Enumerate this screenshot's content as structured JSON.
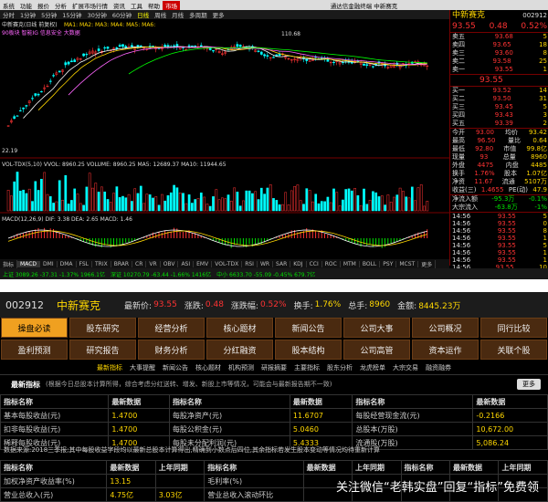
{
  "menubar": {
    "items": [
      "系统",
      "功能",
      "报价",
      "分析",
      "扩展市场行情",
      "资讯",
      "工具",
      "帮助",
      "市场"
    ],
    "title": "通达信金融终端 中新赛克"
  },
  "toolbar": {
    "items": [
      "分时",
      "1分钟",
      "5分钟",
      "15分钟",
      "30分钟",
      "60分钟",
      "日线",
      "周线",
      "月线",
      "多周期",
      "更多"
    ]
  },
  "chart_info": {
    "header": "中新赛克(日线 前复权)",
    "ma_line": "MA1:  MA2:  MA3:  MA4:  MA5:  MA6:",
    "annot1": "90板块 智能IG 信息安全 大数据",
    "vol_label": "VOL-TDX(5,10) VVOL: 8960.25 VOLUME: 8960.25 MA5: 12689.37 MA10: 11944.65",
    "macd_label": "MACD(12,26,9) DIF: 3.38 DEA: 2.65 MACD: 1.46",
    "price_hi": "110.68",
    "price_lo": "22.19"
  },
  "rpanel": {
    "title": "中新赛克",
    "code": "002912",
    "price": "93.55",
    "change": "0.48",
    "pct": "0.52%",
    "asks": [
      [
        "卖五",
        "93.68",
        "5"
      ],
      [
        "卖四",
        "93.65",
        "18"
      ],
      [
        "卖三",
        "93.60",
        "8"
      ],
      [
        "卖二",
        "93.58",
        "25"
      ],
      [
        "卖一",
        "93.55",
        "1"
      ]
    ],
    "bids": [
      [
        "买一",
        "93.52",
        "14"
      ],
      [
        "买二",
        "93.50",
        "31"
      ],
      [
        "买三",
        "93.45",
        "5"
      ],
      [
        "买四",
        "93.43",
        "3"
      ],
      [
        "买五",
        "93.39",
        "2"
      ]
    ],
    "stats": [
      [
        "今开",
        "93.00",
        "均价",
        "93.42"
      ],
      [
        "最高",
        "96.50",
        "量比",
        "0.64"
      ],
      [
        "最低",
        "92.80",
        "市值",
        "99.8亿"
      ],
      [
        "现量",
        "93",
        "总量",
        "8960"
      ],
      [
        "外盘",
        "4475",
        "内盘",
        "4485"
      ],
      [
        "换手",
        "1.76%",
        "股本",
        "1.07亿"
      ],
      [
        "净资",
        "11.67",
        "流通",
        "5107万"
      ],
      [
        "收益(三)",
        "1.4655",
        "PE(动)",
        "47.9"
      ]
    ],
    "flow": [
      [
        "净流入额",
        "-95.3万",
        "-0.1%"
      ],
      [
        "大宗流入",
        "-63.8万",
        "-1%"
      ]
    ],
    "ticks": [
      [
        "14:56",
        "93.55",
        "5"
      ],
      [
        "14:56",
        "93.55",
        "0"
      ],
      [
        "14:56",
        "93.55",
        "8"
      ],
      [
        "14:56",
        "93.55",
        "1"
      ],
      [
        "14:56",
        "93.55",
        "5"
      ],
      [
        "14:56",
        "93.55",
        "1"
      ],
      [
        "14:56",
        "93.55",
        "1"
      ],
      [
        "14:56",
        "93.55",
        "10"
      ],
      [
        "14:56",
        "93.55",
        "1"
      ],
      [
        "14:56",
        "93.55",
        "4"
      ],
      [
        "14:56",
        "93.55",
        "1"
      ],
      [
        "14:56",
        "93.55",
        "0"
      ]
    ]
  },
  "ctabs": {
    "items": [
      "指标",
      "MACD",
      "DMI",
      "DMA",
      "FSL",
      "TRIX",
      "BRAR",
      "CR",
      "VR",
      "OBV",
      "ASI",
      "EMV",
      "VOL-TDX",
      "RSI",
      "WR",
      "SAR",
      "KDJ",
      "CCI",
      "ROC",
      "MTM",
      "BOLL",
      "PSY",
      "MCST",
      "更多"
    ]
  },
  "statusbar": {
    "items": [
      "上证 3089.26  -37.31  -1.37%  1966.1亿",
      "深证 10270.79  -63.44  -1.66%  1416亿",
      "中小 6633.70  -55.09  -0.45%  679.7亿"
    ]
  },
  "stockbar": {
    "code": "002912",
    "name": "中新赛克",
    "latest_lbl": "最新价:",
    "latest": "93.55",
    "chg_lbl": "涨跌:",
    "chg": "0.48",
    "pct_lbl": "涨跌幅:",
    "pct": "0.52%",
    "turn_lbl": "换手:",
    "turn": "1.76%",
    "vol_lbl": "总手:",
    "vol": "8960",
    "amt_lbl": "金额:",
    "amt": "8445.23万"
  },
  "nav1": [
    "操盘必读",
    "股东研究",
    "经营分析",
    "核心题材",
    "新闻公告",
    "公司大事",
    "公司概况",
    "同行比较"
  ],
  "nav2": [
    "盈利预测",
    "研究报告",
    "财务分析",
    "分红融资",
    "股本结构",
    "公司高管",
    "资本运作",
    "关联个股"
  ],
  "subnav": [
    "最新指标",
    "大事提醒",
    "新闻公告",
    "核心题材",
    "机构预测",
    "研报摘要",
    "主要指标",
    "股东分析",
    "龙虎榜单",
    "大宗交易",
    "融资融券"
  ],
  "section": {
    "title": "最新指标",
    "note": "(根据今日总股本计算所得，综合考虑分红送转、增发、新股上市等情况，可能会与最新报告期不一致)",
    "more": "更多"
  },
  "table1": {
    "header": [
      "指标名称",
      "最新数据",
      "指标名称",
      "最新数据",
      "指标名称",
      "最新数据"
    ],
    "rows": [
      [
        "基本每股收益(元)",
        "1.4700",
        "每股净资产(元)",
        "11.6707",
        "每股经营现金流(元)",
        "-0.2166"
      ],
      [
        "扣非每股收益(元)",
        "1.4700",
        "每股公积金(元)",
        "5.0460",
        "总股本(万股)",
        "10,672.00"
      ],
      [
        "稀释每股收益(元)",
        "1.4700",
        "每股未分配利润(元)",
        "5.4333",
        "流通股(万股)",
        "5,086.24"
      ]
    ]
  },
  "footnote": "数据来源:2018三季报;其中每股收益字段均以最新总股本计算得出,精确到小数点后四位,其余指标若发生股本变动等情况均待重新计算",
  "table2": {
    "header": [
      "指标名称",
      "最新数据",
      "上年同期",
      "指标名称",
      "最新数据",
      "上年同期",
      "指标名称",
      "最新数据",
      "上年同期"
    ],
    "rows": [
      [
        "加权净资产收益率(%)",
        "13.15",
        "",
        "毛利率(%)",
        "",
        "",
        "",
        "",
        ""
      ],
      [
        "营业总收入(元)",
        "4.75亿",
        "3.03亿",
        "营业总收入滚动环比",
        "",
        "",
        "",
        "",
        ""
      ]
    ]
  },
  "watermark": "关注微信“老韩实盘”回复“指标”免费领",
  "colors": {
    "up": "#ff3333",
    "down": "#00e000",
    "accent": "#ffd700",
    "nav_on": "#f0a020"
  }
}
